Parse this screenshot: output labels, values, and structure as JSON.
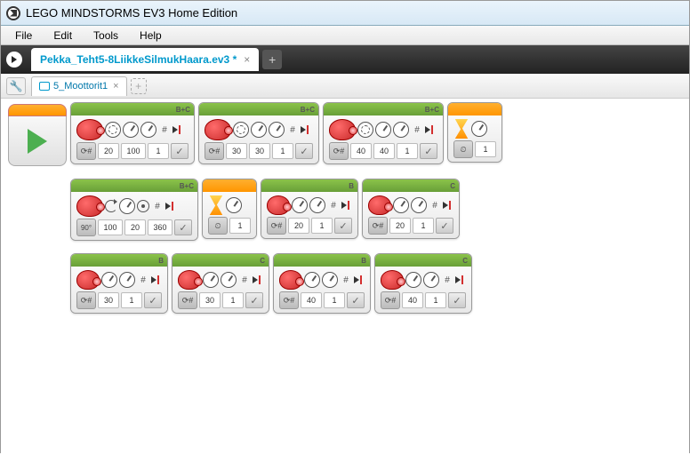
{
  "window": {
    "title": "LEGO MINDSTORMS EV3 Home Edition"
  },
  "menu": {
    "file": "File",
    "edit": "Edit",
    "tools": "Tools",
    "help": "Help"
  },
  "project": {
    "name": "Pekka_Teht5-8LiikkeSilmukHaara.ev3 *"
  },
  "program": {
    "name": "5_Moottorit1"
  },
  "icons": {
    "close": "×",
    "add": "+",
    "hash": "#",
    "check": "✓",
    "clock": "⏲",
    "loop": "⟳",
    "deg90": "90°"
  },
  "blocks": {
    "row1": [
      {
        "type": "move",
        "port": "B+C",
        "mode": "#",
        "v1": "20",
        "v2": "100",
        "v3": "1"
      },
      {
        "type": "move",
        "port": "B+C",
        "mode": "#",
        "v1": "30",
        "v2": "30",
        "v3": "1"
      },
      {
        "type": "move",
        "port": "B+C",
        "mode": "#",
        "v1": "40",
        "v2": "40",
        "v3": "1"
      },
      {
        "type": "wait",
        "mode": "clock",
        "v1": "1"
      }
    ],
    "row2": [
      {
        "type": "tank",
        "port": "B+C",
        "mode": "90",
        "v1": "100",
        "v2": "20",
        "v3": "360"
      },
      {
        "type": "wait",
        "mode": "clock",
        "v1": "1"
      },
      {
        "type": "motor",
        "port": "B",
        "mode": "#",
        "v1": "20",
        "v2": "1"
      },
      {
        "type": "motor",
        "port": "C",
        "mode": "#",
        "v1": "20",
        "v2": "1"
      }
    ],
    "row3": [
      {
        "type": "motor",
        "port": "B",
        "mode": "#",
        "v1": "30",
        "v2": "1"
      },
      {
        "type": "motor",
        "port": "C",
        "mode": "#",
        "v1": "30",
        "v2": "1"
      },
      {
        "type": "motor",
        "port": "B",
        "mode": "#",
        "v1": "40",
        "v2": "1"
      },
      {
        "type": "motor",
        "port": "C",
        "mode": "#",
        "v1": "40",
        "v2": "1"
      }
    ]
  }
}
